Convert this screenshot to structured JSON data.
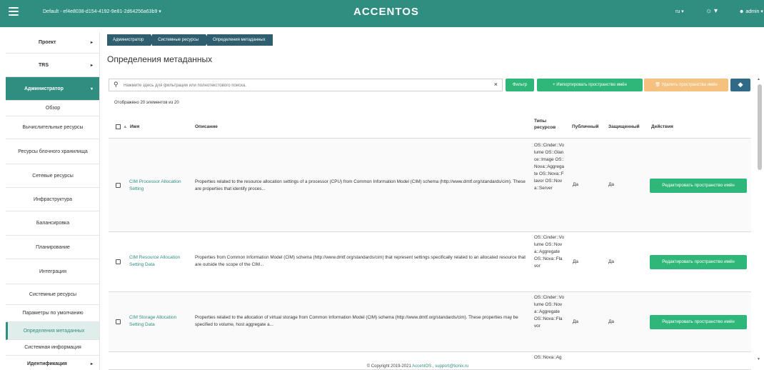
{
  "topbar": {
    "project": "Default - ef4e8038-d154-4192-9e81-2d64256a63b9 ▾",
    "brand": "ACCENTOS",
    "lang": "ru ▾",
    "theme": "☼ ▾",
    "user": "admin ▾"
  },
  "sidebar": {
    "items": [
      {
        "label": "Проект",
        "arrow": "▸"
      },
      {
        "label": "TRS",
        "arrow": "▸"
      },
      {
        "label": "Администратор",
        "arrow": "▾"
      },
      {
        "label": "Обзор"
      },
      {
        "label": "Вычислительные ресурсы"
      },
      {
        "label": "Ресурсы блочного хранилища"
      },
      {
        "label": "Сетевые ресурсы"
      },
      {
        "label": "Инфраструктура"
      },
      {
        "label": "Балансировка"
      },
      {
        "label": "Планирование"
      },
      {
        "label": "Интеграция"
      },
      {
        "label": "Системные ресурсы"
      },
      {
        "label": "Параметры по умолчанию"
      },
      {
        "label": "Определения метаданных"
      },
      {
        "label": "Системная информация"
      },
      {
        "label": "Идентификация",
        "arrow": "▸"
      }
    ]
  },
  "breadcrumb": [
    "Администратор",
    "Системные ресурсы",
    "Определения метаданных"
  ],
  "page_title": "Определения метаданных",
  "filter": {
    "placeholder": "Нажмите здесь для фильтрации или полнотекстового поиска.",
    "clear": "×"
  },
  "buttons": {
    "filter": "Фильтр",
    "import": "+ Импортировать пространство имён",
    "delete": "🗑 Удалить пространства имён",
    "info": "❖"
  },
  "count_text": "Отображено 20 элементов из 20",
  "table": {
    "headers": {
      "sort": "▲",
      "name": "Имя",
      "description": "Описание",
      "resource_types": "Типы ресурсов",
      "public": "Публичный",
      "protected": "Защищенный",
      "actions": "Действия"
    },
    "rows": [
      {
        "name": "CIM Processor Allocation Setting",
        "description": "Properties related to the resource allocation settings of a processor (CPU) from Common Information Model (CIM) schema (http://www.dmtf.org/standards/cim). These are properties that identify proces...",
        "resource_types": "OS::Cinder::Volume OS::Glance::Image OS::Nova::Aggregate OS::Nova::Flavor OS::Nova::Server",
        "public": "Да",
        "protected": "Да",
        "action": "Редактировать пространство имён"
      },
      {
        "name": "CIM Resource Allocation Setting Data",
        "description": "Properties from Common Information Model (CIM) schema (http://www.dmtf.org/standards/cim) that represent settings specifically related to an allocated resource that are outside the scope of the CIM...",
        "resource_types": "OS::Cinder::Volume OS::Nova::Aggregate OS::Nova::Flavor",
        "public": "Да",
        "protected": "Да",
        "action": "Редактировать пространство имён"
      },
      {
        "name": "CIM Storage Allocation Setting Data",
        "description": "Properties related to the allocation of virtual storage from Common Information Model (CIM) schema (http://www.dmtf.org/standards/cim). These properties may be specified to volume, host aggregate a...",
        "resource_types": "OS::Cinder::Volume OS::Nova::Aggregate OS::Nova::Flavor",
        "public": "Да",
        "protected": "Да",
        "action": "Редактировать пространство имён"
      },
      {
        "name": "",
        "description": "",
        "resource_types": "OS::Nova::Ag",
        "public": "",
        "protected": "",
        "action": ""
      }
    ]
  },
  "footer": {
    "copyright": "© Copyright 2019-2021 ",
    "brand_link": "AccentOS",
    "separator": " , ",
    "email": "support@tionix.ru"
  }
}
